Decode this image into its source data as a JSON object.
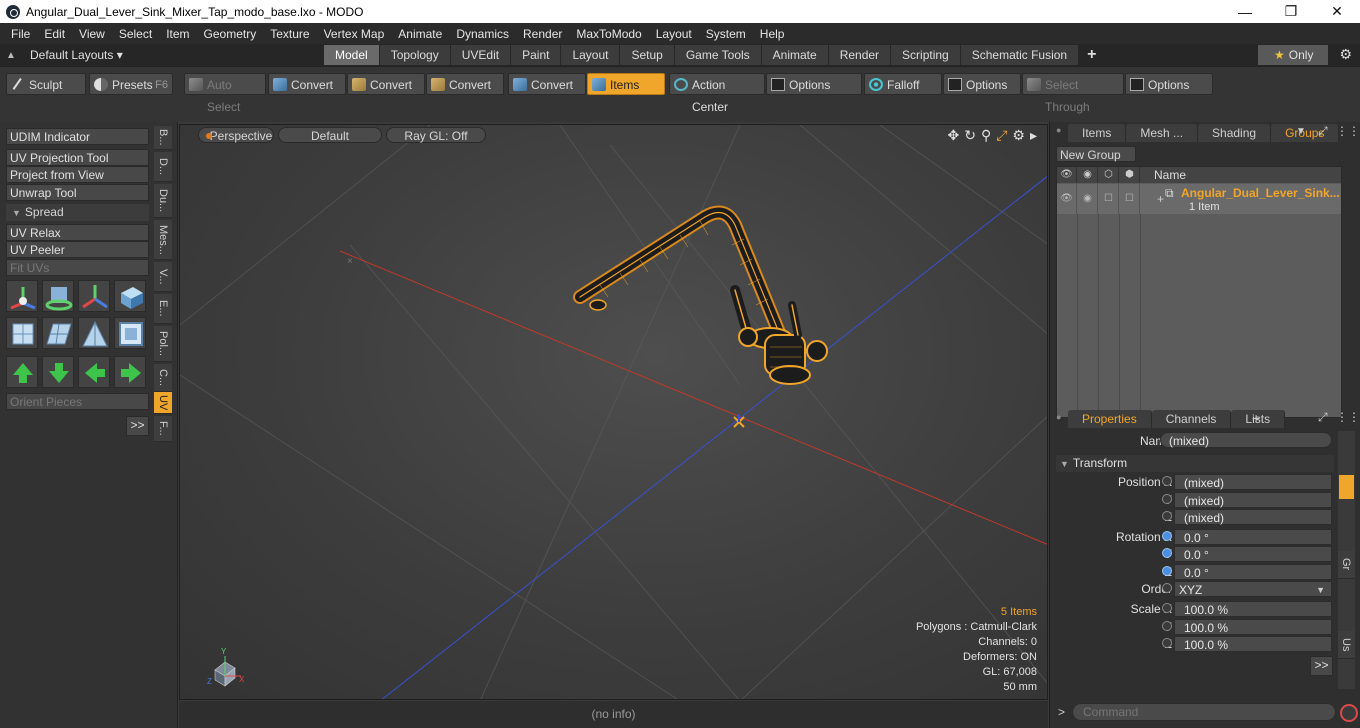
{
  "titlebar": {
    "title": "Angular_Dual_Lever_Sink_Mixer_Tap_modo_base.lxo - MODO",
    "minimize": "—",
    "maximize": "❐",
    "close": "✕"
  },
  "menubar": [
    "File",
    "Edit",
    "View",
    "Select",
    "Item",
    "Geometry",
    "Texture",
    "Vertex Map",
    "Animate",
    "Dynamics",
    "Render",
    "MaxToModo",
    "Layout",
    "System",
    "Help"
  ],
  "layoutbar": {
    "layout_select": "Default Layouts ▾",
    "tabs": [
      "Model",
      "Topology",
      "UVEdit",
      "Paint",
      "Layout",
      "Setup",
      "Game Tools",
      "Animate",
      "Render",
      "Scripting",
      "Schematic Fusion"
    ],
    "active_tab": "Model",
    "add_tab": "+",
    "only_label": "Only"
  },
  "toolbar": {
    "sculpt": "Sculpt",
    "presets": "Presets",
    "presets_hotkey": "F6",
    "auto_select": "Auto Select",
    "convert": "Convert",
    "items": "Items",
    "action_center": "Action Center",
    "options": "Options",
    "falloff": "Falloff",
    "select_through": "Select Through"
  },
  "leftpanel": {
    "buttons": {
      "udim": "UDIM Indicator",
      "uv_projection": "UV Projection Tool",
      "project_view": "Project from View",
      "unwrap": "Unwrap Tool",
      "spread": "Spread",
      "uv_relax": "UV Relax",
      "uv_peeler": "UV Peeler",
      "fit_uvs": "Fit UVs",
      "orient": "Orient Pieces",
      "more": ">>"
    },
    "vtabs": [
      "B...",
      "D...",
      "Du...",
      "Mes...",
      "V...",
      "E...",
      "Pol...",
      "C...",
      "UV",
      "F..."
    ]
  },
  "viewport": {
    "view_mode": "Perspective",
    "shading": "Default",
    "raygl": "Ray GL: Off",
    "info": {
      "items": "5 Items",
      "polygons": "Polygons : Catmull-Clark",
      "channels": "Channels: 0",
      "deformers": "Deformers: ON",
      "gl": "GL: 67,008",
      "distance": "50 mm"
    },
    "status": "(no info)"
  },
  "groups_panel": {
    "tabs": [
      "Items",
      "Mesh ...",
      "Shading",
      "Groups"
    ],
    "active_tab": "Groups",
    "new_group": "New Group",
    "name_header": "Name",
    "group_name": "Angular_Dual_Lever_Sink...",
    "group_count": "1 Item"
  },
  "properties_panel": {
    "tabs": [
      "Properties",
      "Channels",
      "Lists"
    ],
    "active_tab": "Properties",
    "name_label": "Name",
    "name_value": "(mixed)",
    "transform_label": "Transform",
    "rows": [
      {
        "label": "Position X",
        "value": "(mixed)"
      },
      {
        "label": "Y",
        "value": "(mixed)"
      },
      {
        "label": "Z",
        "value": "(mixed)"
      },
      {
        "label": "Rotation X",
        "value": "0.0 °"
      },
      {
        "label": "Y",
        "value": "0.0 °"
      },
      {
        "label": "Z",
        "value": "0.0 °"
      },
      {
        "label": "Order",
        "value": "XYZ"
      },
      {
        "label": "Scale X",
        "value": "100.0 %"
      },
      {
        "label": "Y",
        "value": "100.0 %"
      },
      {
        "label": "Z",
        "value": "100.0 %"
      }
    ],
    "more": ">>",
    "side_tabs": [
      "Gr",
      "Us"
    ]
  },
  "command": {
    "prompt": ">",
    "placeholder": "Command"
  },
  "colors": {
    "accent": "#f0a52b",
    "axis_x": "#c0392b",
    "axis_z": "#3a4fd0"
  }
}
